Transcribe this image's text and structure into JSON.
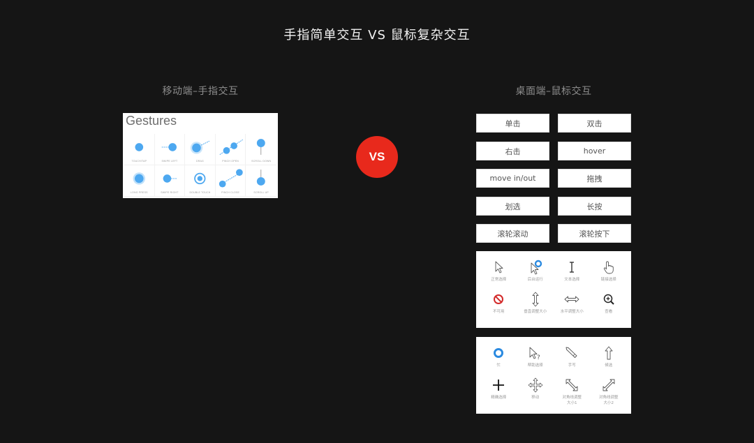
{
  "page": {
    "title": "手指简单交互 VS 鼠标复杂交互"
  },
  "left_section": {
    "title": "移动端–手指交互",
    "card_title": "Gestures",
    "accent_color": "#4da8f0",
    "gestures": [
      {
        "label": "TOUCH/TAP",
        "icon": "tap-icon"
      },
      {
        "label": "SWIPE LEFT",
        "icon": "swipe-left-icon"
      },
      {
        "label": "DRAG",
        "icon": "drag-icon"
      },
      {
        "label": "PINCH OPEN",
        "icon": "pinch-open-icon"
      },
      {
        "label": "SCROLL DOWN",
        "icon": "scroll-down-icon"
      },
      {
        "label": "LONG PRESS",
        "icon": "long-press-icon"
      },
      {
        "label": "SWIPE RIGHT",
        "icon": "swipe-right-icon"
      },
      {
        "label": "DOUBLE TOUCH",
        "icon": "double-touch-icon"
      },
      {
        "label": "PINCH CLOSE",
        "icon": "pinch-close-icon"
      },
      {
        "label": "SCROLL UP",
        "icon": "scroll-up-icon"
      }
    ]
  },
  "vs_badge": {
    "label": "VS",
    "color": "#e8291c"
  },
  "right_section": {
    "title": "桌面端–鼠标交互",
    "interactions": [
      "单击",
      "双击",
      "右击",
      "hover",
      "move in/out",
      "拖拽",
      "划选",
      "长按",
      "滚轮滚动",
      "滚轮按下"
    ],
    "cursor_panel_1": [
      {
        "label": "正常选择",
        "icon": "arrow-pointer-icon"
      },
      {
        "label": "后台运行",
        "icon": "arrow-busy-icon"
      },
      {
        "label": "文本选择",
        "icon": "text-beam-icon"
      },
      {
        "label": "链接选择",
        "icon": "hand-pointer-icon"
      },
      {
        "label": "不可用",
        "icon": "unavailable-icon"
      },
      {
        "label": "垂直调整大小",
        "icon": "resize-vertical-icon"
      },
      {
        "label": "水平调整大小",
        "icon": "resize-horizontal-icon"
      },
      {
        "label": "查看",
        "icon": "zoom-in-icon"
      }
    ],
    "cursor_panel_2": [
      {
        "label": "忙",
        "icon": "busy-ring-icon"
      },
      {
        "label": "帮助选择",
        "icon": "help-select-icon"
      },
      {
        "label": "手写",
        "icon": "handwriting-pen-icon"
      },
      {
        "label": "候选",
        "icon": "alternate-arrow-up-icon"
      },
      {
        "label": "精确选择",
        "icon": "precision-cross-icon"
      },
      {
        "label": "移动",
        "icon": "move-icon"
      },
      {
        "label": "对角线调整\n大小1",
        "icon": "resize-diagonal-1-icon"
      },
      {
        "label": "对角线调整\n大小2",
        "icon": "resize-diagonal-2-icon"
      }
    ]
  }
}
